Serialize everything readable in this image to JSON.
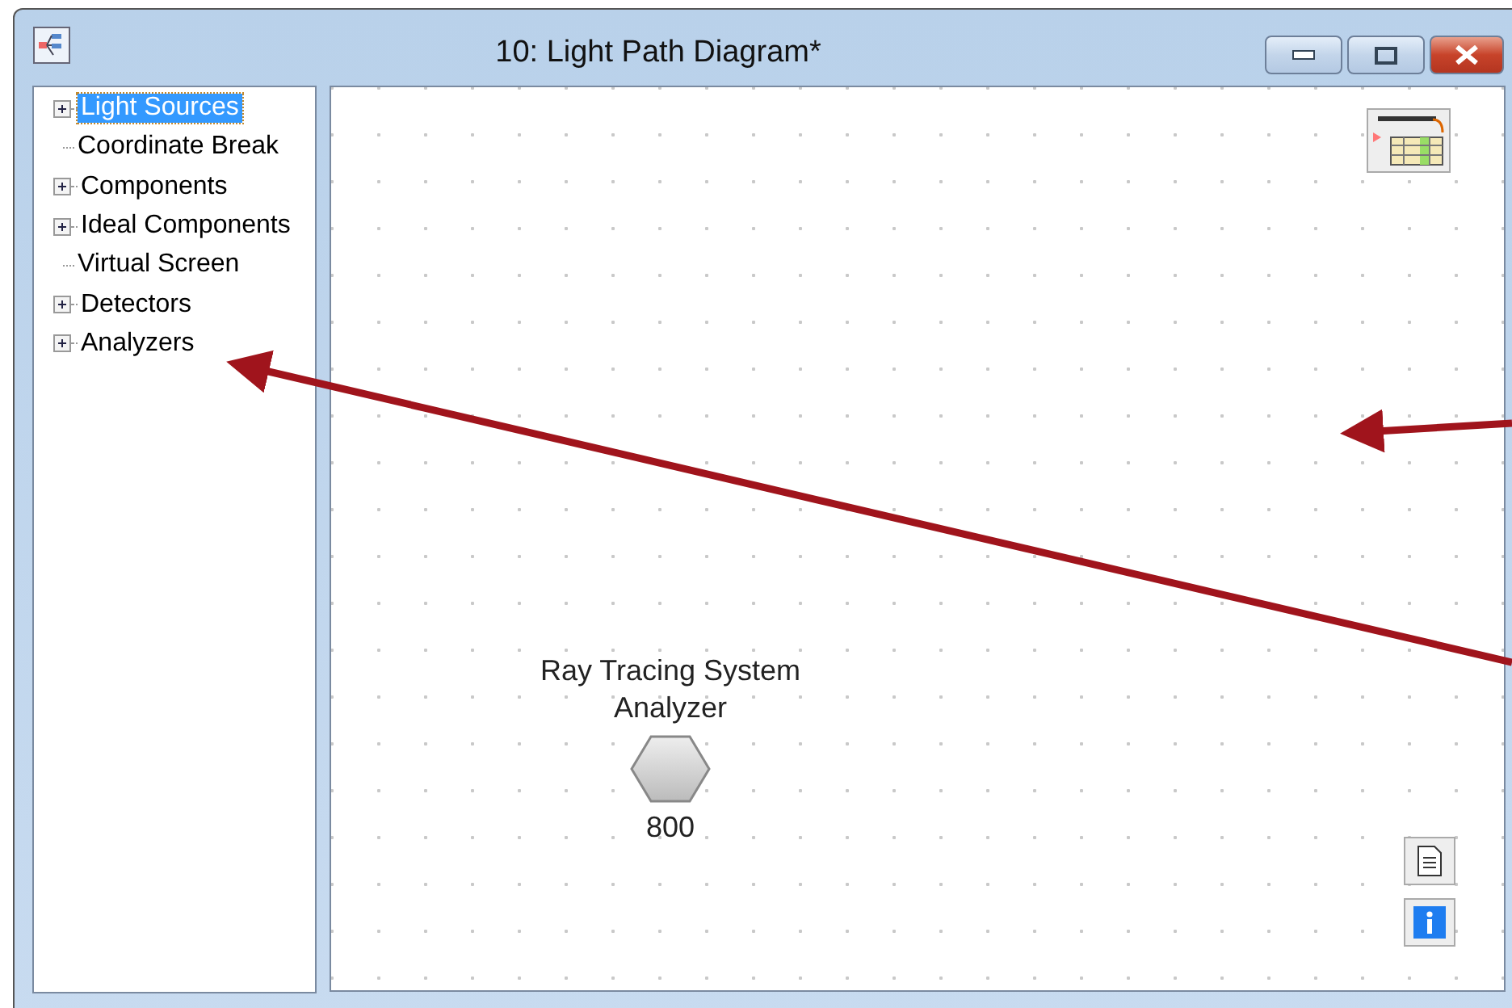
{
  "window": {
    "title": "10: Light Path Diagram*"
  },
  "tree": {
    "items": [
      {
        "label": "Light Sources",
        "expandable": true,
        "selected": true
      },
      {
        "label": "Coordinate Break",
        "expandable": false,
        "selected": false
      },
      {
        "label": "Components",
        "expandable": true,
        "selected": false
      },
      {
        "label": "Ideal Components",
        "expandable": true,
        "selected": false
      },
      {
        "label": "Virtual Screen",
        "expandable": false,
        "selected": false
      },
      {
        "label": "Detectors",
        "expandable": true,
        "selected": false
      },
      {
        "label": "Analyzers",
        "expandable": true,
        "selected": false
      }
    ]
  },
  "canvas": {
    "nodes": [
      {
        "label": "Ray Tracing System Analyzer",
        "number": "800"
      }
    ]
  }
}
